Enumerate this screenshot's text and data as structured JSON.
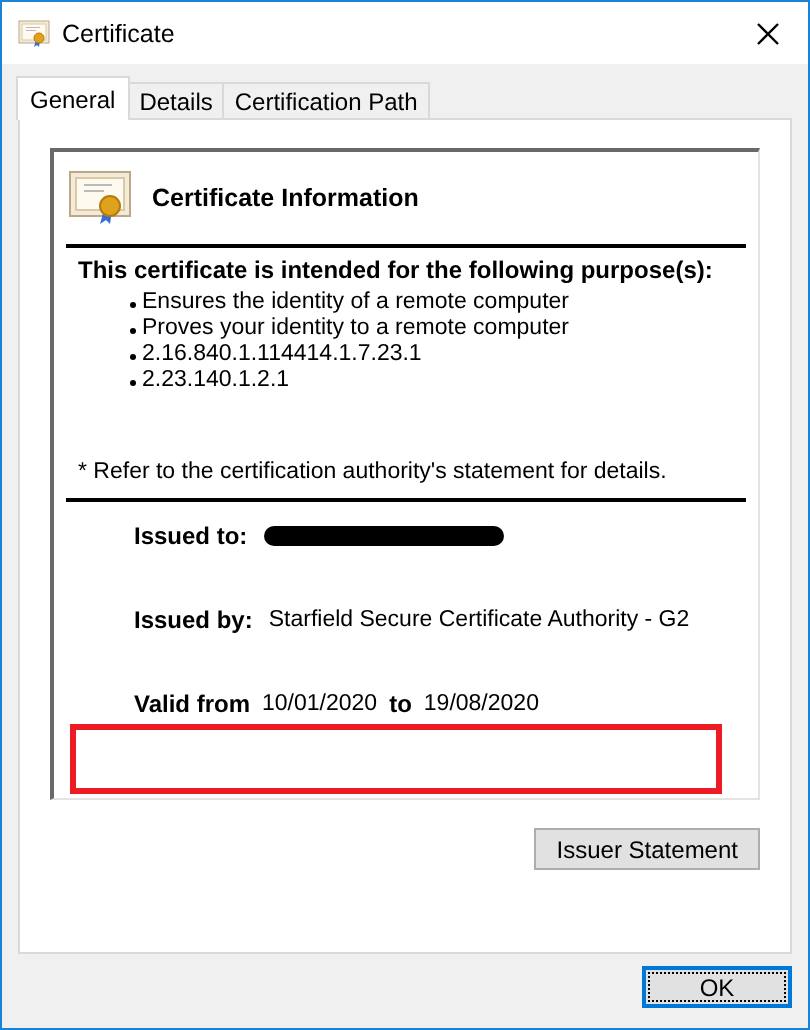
{
  "window": {
    "title": "Certificate"
  },
  "tabs": [
    {
      "label": "General",
      "selected": true
    },
    {
      "label": "Details",
      "selected": false
    },
    {
      "label": "Certification Path",
      "selected": false
    }
  ],
  "info": {
    "heading": "Certificate Information",
    "purpose_heading": "This certificate is intended for the following purpose(s):",
    "purposes": [
      "Ensures the identity of a remote computer",
      "Proves your identity to a remote computer",
      "2.16.840.1.114414.1.7.23.1",
      "2.23.140.1.2.1"
    ],
    "note": "* Refer to the certification authority's statement for details.",
    "issued_to": {
      "label": "Issued to:",
      "redacted": true
    },
    "issued_by": {
      "label": "Issued by:",
      "value": "Starfield Secure Certificate Authority - G2"
    },
    "valid": {
      "from_label": "Valid from",
      "from": "10/01/2020",
      "to_label": "to",
      "to": "19/08/2020"
    },
    "highlight_box": true
  },
  "buttons": [
    {
      "label": "Issuer Statement",
      "default": false
    },
    {
      "label": "OK",
      "default": true
    }
  ]
}
